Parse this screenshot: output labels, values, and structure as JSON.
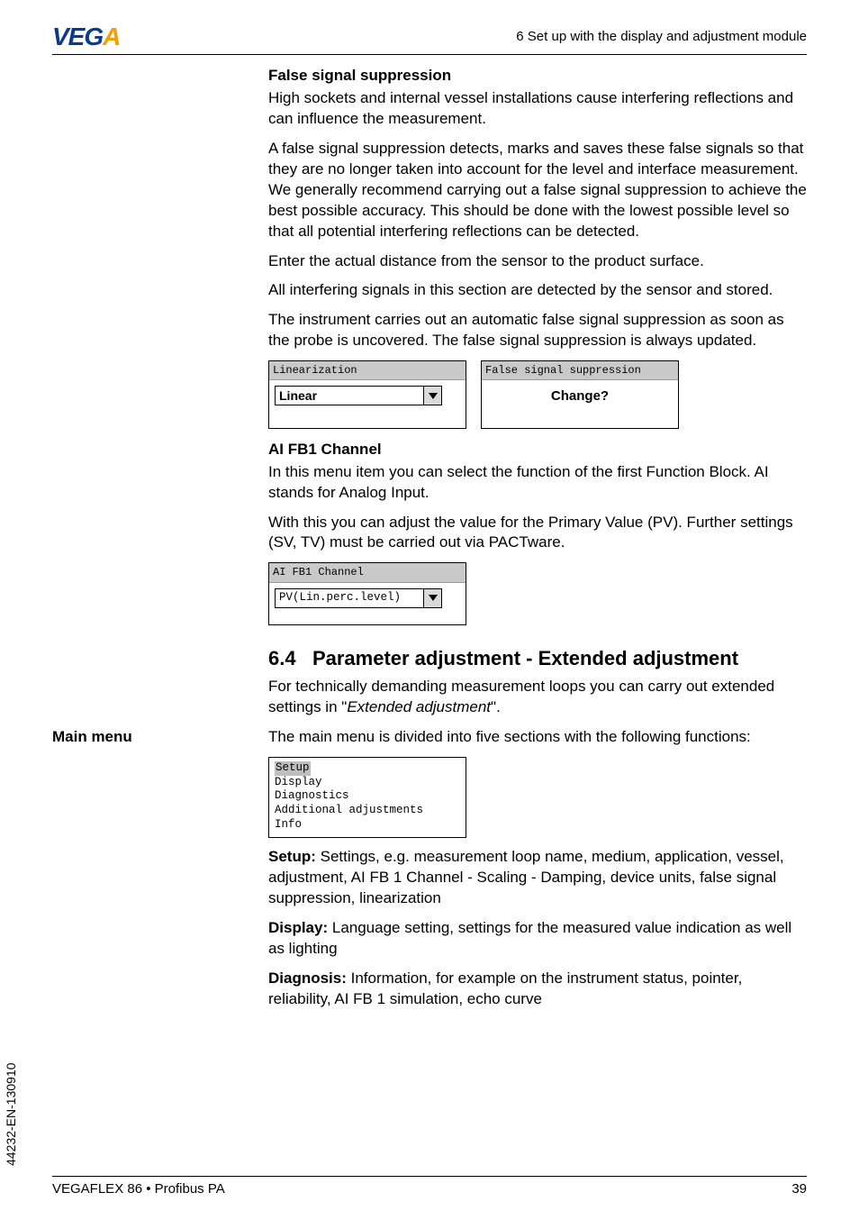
{
  "brand": {
    "name_head": "VEG",
    "name_tail": "A"
  },
  "header": {
    "chapter_ref": "6 Set up with the display and adjustment module"
  },
  "s1": {
    "title": "False signal suppression",
    "p1": "High sockets and internal vessel installations cause interfering reflections and can influence the measurement.",
    "p2": "A false signal suppression detects, marks and saves these false signals so that they are no longer taken into account for the level and interface measurement. We generally recommend carrying out a false signal suppression to achieve the best possible accuracy. This should be done with the lowest possible level so that all potential interfering reflections can be detected.",
    "p3": "Enter the actual distance from the sensor to the product surface.",
    "p4": "All interfering signals in this section are detected by the sensor and stored.",
    "p5": "The instrument carries out an automatic false signal suppression as soon as the probe is uncovered. The false signal suppression is always updated."
  },
  "win_lin": {
    "title": "Linearization",
    "value": "Linear"
  },
  "win_fss": {
    "title": "False signal suppression",
    "body": "Change?"
  },
  "s2": {
    "title": "AI FB1 Channel",
    "p1": "In this menu item you can select the function of the first Function Block. AI stands for Analog Input.",
    "p2": "With this you can adjust the value for the Primary Value (PV). Further settings (SV, TV) must be carried out via PACTware."
  },
  "win_ai": {
    "title": "AI FB1 Channel",
    "value": "PV(Lin.perc.level)"
  },
  "h64": {
    "num": "6.4",
    "title": "Parameter adjustment - Extended adjustment"
  },
  "p64": {
    "lead_a": "For technically demanding measurement loops you can carry out extended settings in \"",
    "lead_em": "Extended adjustment",
    "lead_b": "\"."
  },
  "side": {
    "main_menu": "Main menu"
  },
  "mm": {
    "intro": "The main menu is divided into five sections with the following functions:",
    "items": {
      "i0": "Setup",
      "i1": "Display",
      "i2": "Diagnostics",
      "i3": "Additional adjustments",
      "i4": "Info"
    },
    "setup_label": "Setup:",
    "setup_text": " Settings, e.g. measurement loop name, medium, application, vessel, adjustment, AI FB 1 Channel - Scaling - Damping, device units, false signal suppression, linearization",
    "display_label": "Display:",
    "display_text": " Language setting, settings for the measured value indication as well as lighting",
    "diag_label": "Diagnosis:",
    "diag_text": " Information, for example on the instrument status, pointer, reliability, AI FB 1 simulation, echo curve"
  },
  "footer": {
    "doc_code": "44232-EN-130910",
    "product": "VEGAFLEX 86 • Profibus PA",
    "page": "39"
  }
}
